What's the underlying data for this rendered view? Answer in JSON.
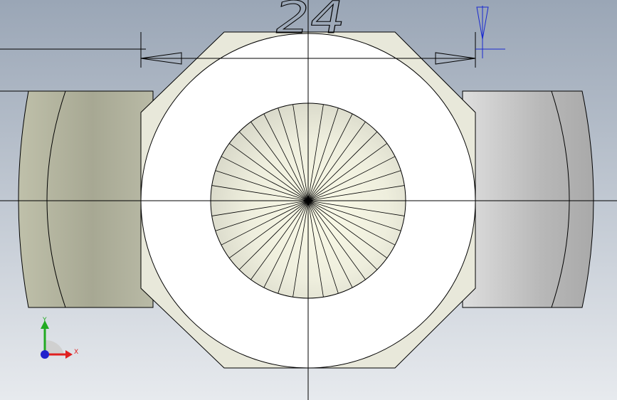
{
  "view": {
    "type": "cad-part-front-view",
    "background_top": "#9aa6b6",
    "background_bottom": "#e7eaee"
  },
  "dimension": {
    "value": "24",
    "units": "mm-shown-as-integer",
    "line_color": "#000000"
  },
  "triad": {
    "x_label": "X",
    "y_label": "Y",
    "x_color": "#e02020",
    "y_color": "#22aa22",
    "z_color": "#2222cc"
  },
  "part": {
    "face_color": "#ffffff",
    "edge_color": "#000000",
    "left_shade": "#a9ab96",
    "right_shade": "#c2c2c2"
  },
  "hole": {
    "spokes": 40
  }
}
